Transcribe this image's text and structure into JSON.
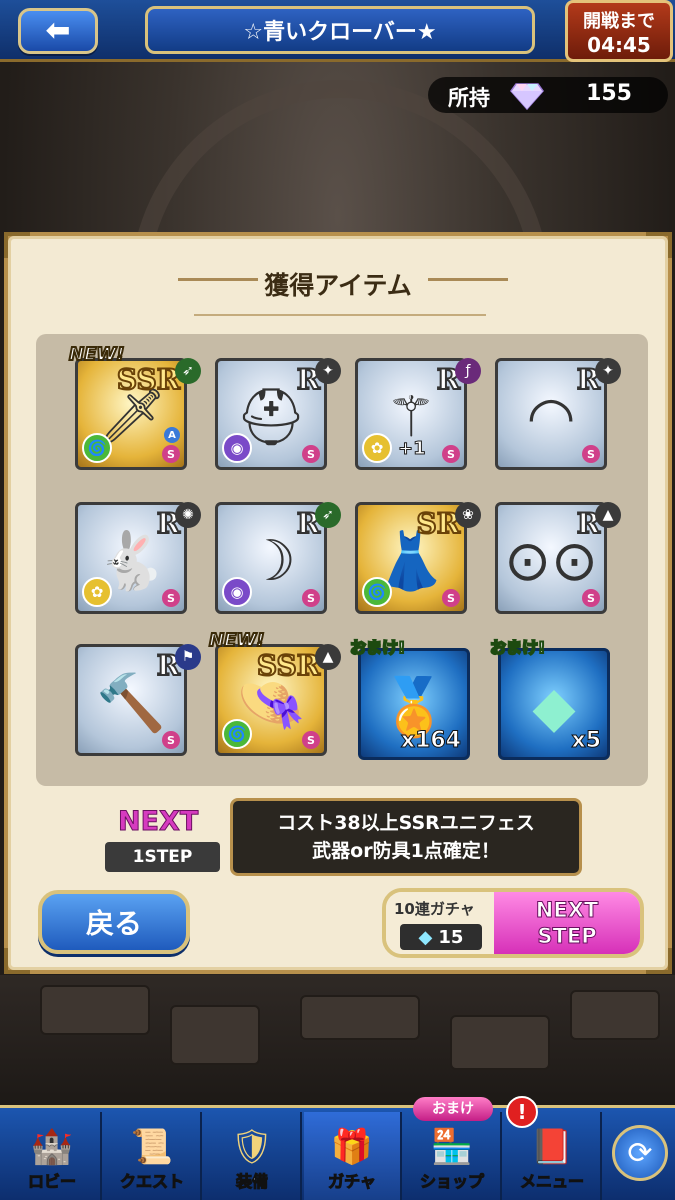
{
  "header": {
    "back_icon": "arrow-left-icon",
    "title": "☆青いクローバー★",
    "timer_label": "開戦まで",
    "timer_value": "04:45"
  },
  "currency": {
    "label": "所持",
    "icon": "diamond-gem-icon",
    "value": "155"
  },
  "panel": {
    "title": "獲得アイテム"
  },
  "items": [
    {
      "rarity": "SSR",
      "type": "ssr",
      "new_label": "NEW!",
      "art_icon": "sword-icon",
      "element": "wind",
      "extra": "A",
      "s": "S"
    },
    {
      "rarity": "R",
      "type": "r",
      "art_icon": "helmet-icon",
      "element": "dark",
      "s": "S"
    },
    {
      "rarity": "R",
      "type": "r",
      "art_icon": "staff-icon",
      "element": "light",
      "plus": "+1",
      "s": "S"
    },
    {
      "rarity": "R",
      "type": "r",
      "art_icon": "headband-icon",
      "element": "",
      "s": "S"
    },
    {
      "rarity": "R",
      "type": "r",
      "art_icon": "creature-icon",
      "element": "light",
      "s": "S"
    },
    {
      "rarity": "R",
      "type": "r",
      "art_icon": "bow-icon",
      "element": "dark",
      "s": "S"
    },
    {
      "rarity": "SR",
      "type": "sr",
      "art_icon": "dress-icon",
      "element": "wind",
      "s": "S"
    },
    {
      "rarity": "R",
      "type": "r",
      "art_icon": "goggles-icon",
      "element": "",
      "s": "S"
    },
    {
      "rarity": "R",
      "type": "r",
      "art_icon": "hammer-icon",
      "element": "",
      "s": "S"
    },
    {
      "rarity": "SSR",
      "type": "ssr",
      "new_label": "NEW!",
      "art_icon": "hat-icon",
      "element": "wind",
      "s": "S"
    },
    {
      "type": "bonus",
      "omake_label": "おまけ!",
      "art_icon": "medal-icon",
      "quantity": "x164"
    },
    {
      "type": "bonus",
      "omake_label": "おまけ!",
      "art_icon": "crystal-icon",
      "quantity": "x5"
    }
  ],
  "next": {
    "label": "NEXT",
    "step": "1STEP",
    "desc_line1": "コスト38以上SSRユニフェス",
    "desc_line2": "武器or防具1点確定！"
  },
  "buttons": {
    "back": "戻る",
    "gacha_label": "10連ガチャ",
    "gacha_cost": "15",
    "next_step_line1": "NEXT",
    "next_step_line2": "STEP"
  },
  "nav": [
    {
      "label": "ロビー",
      "icon": "castle-icon"
    },
    {
      "label": "クエスト",
      "icon": "scroll-map-icon"
    },
    {
      "label": "装備",
      "icon": "armor-icon"
    },
    {
      "label": "ガチャ",
      "icon": "treasure-chest-icon",
      "active": true
    },
    {
      "label": "ショップ",
      "icon": "shop-icon"
    },
    {
      "label": "メニュー",
      "icon": "menu-icon"
    }
  ],
  "nav_badges": {
    "shop_omake": "おまけ",
    "menu_alert": "!"
  },
  "colors": {
    "accent_blue": "#1f5bbd",
    "gold_border": "#d9c27c",
    "next_pink": "#d63bbf"
  }
}
